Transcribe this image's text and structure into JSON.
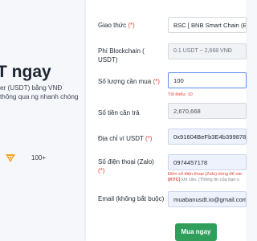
{
  "hero": {
    "title": "T ngay",
    "description": "er (USDT) bằng VNĐ thông qua ng nhanh chóng",
    "count": "100+",
    "logo_color": "#f5a623"
  },
  "form": {
    "protocol": {
      "label": "Giao thức",
      "required": "(*)",
      "value": "BSC [ BNB Smart Chain (BEP20) ]"
    },
    "fee": {
      "label": "Phí Blockchain ( USDT)",
      "value": "0.1 USDT ~ 2,668 VNĐ"
    },
    "quantity": {
      "label": "Số lượng cần mua",
      "required": "(*)",
      "value": "100",
      "note": "Tối thiểu: 10"
    },
    "amount": {
      "label": "Số tiền cần trả",
      "value": "2,670,668"
    },
    "wallet": {
      "label": "Địa chỉ ví USDT",
      "required": "(*)",
      "value": "0x91604BeFb3E4b399878E"
    },
    "phone": {
      "label": "Số điện thoại (Zalo)",
      "required": "(*)",
      "value": "0974457178",
      "note_main": "Điền số điện thoại (Zalo) dùng để xác",
      "note_bold": "(KYC)",
      "note_rest": " khi cần. (Thông tin của bạn s"
    },
    "email": {
      "label": "Email (không bắt buộc)",
      "value": "muabanusdt.io@gmail.com"
    },
    "submit_label": "Mua ngay"
  }
}
